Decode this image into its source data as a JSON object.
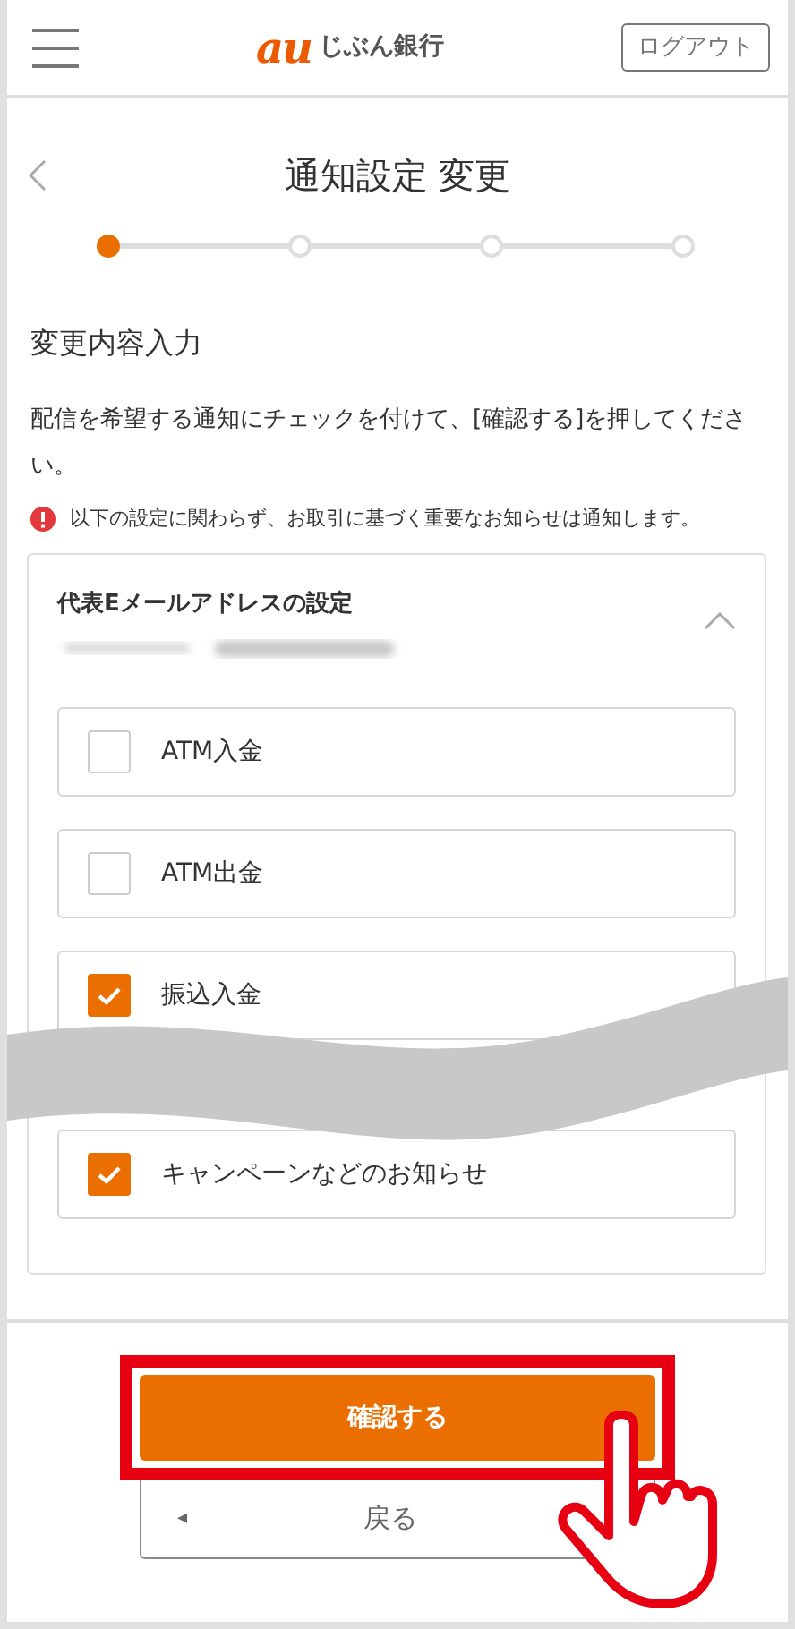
{
  "header": {
    "logo_mark": "au",
    "logo_text": "じぶん銀行",
    "logout_button": "ログアウト"
  },
  "page_title": "通知設定 変更",
  "stepper": [
    {
      "current": true
    },
    {
      "current": false
    },
    {
      "current": false
    },
    {
      "current": false
    }
  ],
  "section_heading": "変更内容入力",
  "instruction": "配信を希望する通知にチェックを付けて、[確認する]を押してください。",
  "notice": "以下の設定に関わらず、お取引に基づく重要なお知らせは通知します。",
  "panel": {
    "title": "代表Eメールアドレスの設定",
    "expanded": true,
    "options": [
      {
        "label": "ATM入金",
        "checked": false
      },
      {
        "label": "ATM出金",
        "checked": false
      },
      {
        "label": "振込入金",
        "checked": true
      },
      {
        "label": "キャンペーンなどのお知らせ",
        "checked": true
      }
    ]
  },
  "confirm_button": "確認する",
  "back_button": {
    "icon": "◂",
    "label": "戻る"
  }
}
